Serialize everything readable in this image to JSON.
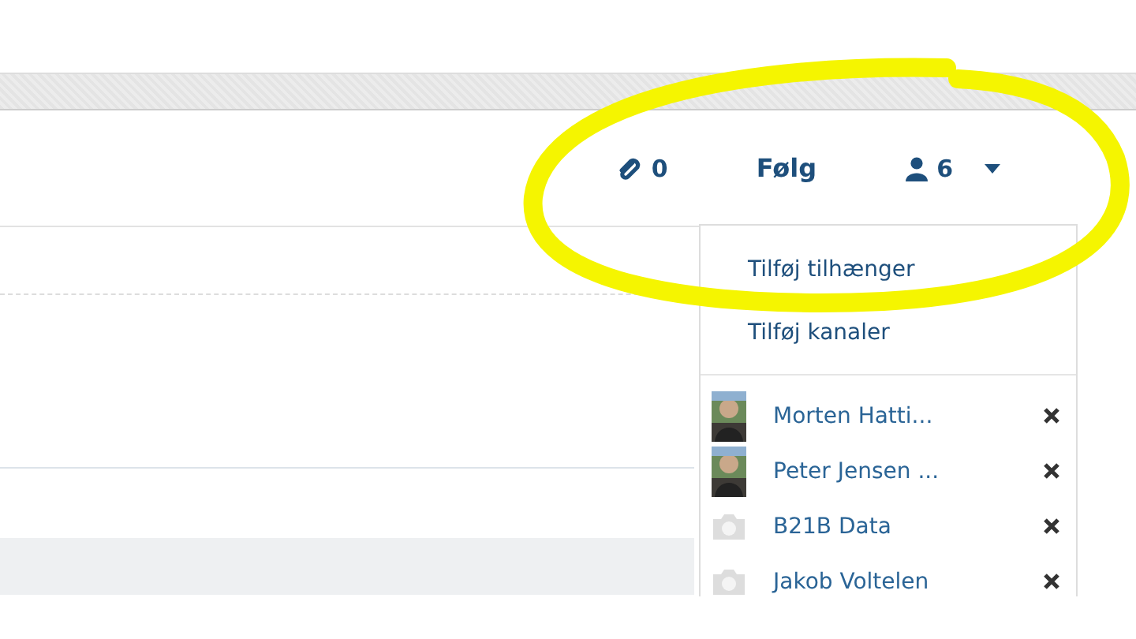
{
  "toolbar": {
    "attachments": "0",
    "follow": "Følg",
    "followers": "6"
  },
  "dropdown": {
    "actions": [
      "Tilføj tilhænger",
      "Tilføj kanaler"
    ],
    "followers": [
      {
        "name": "Morten Hatti..."
      },
      {
        "name": "Peter Jensen ..."
      },
      {
        "name": "B21B Data",
        "kind": "placeholder"
      },
      {
        "name": "Jakob Voltelen",
        "kind": "placeholder"
      }
    ]
  }
}
